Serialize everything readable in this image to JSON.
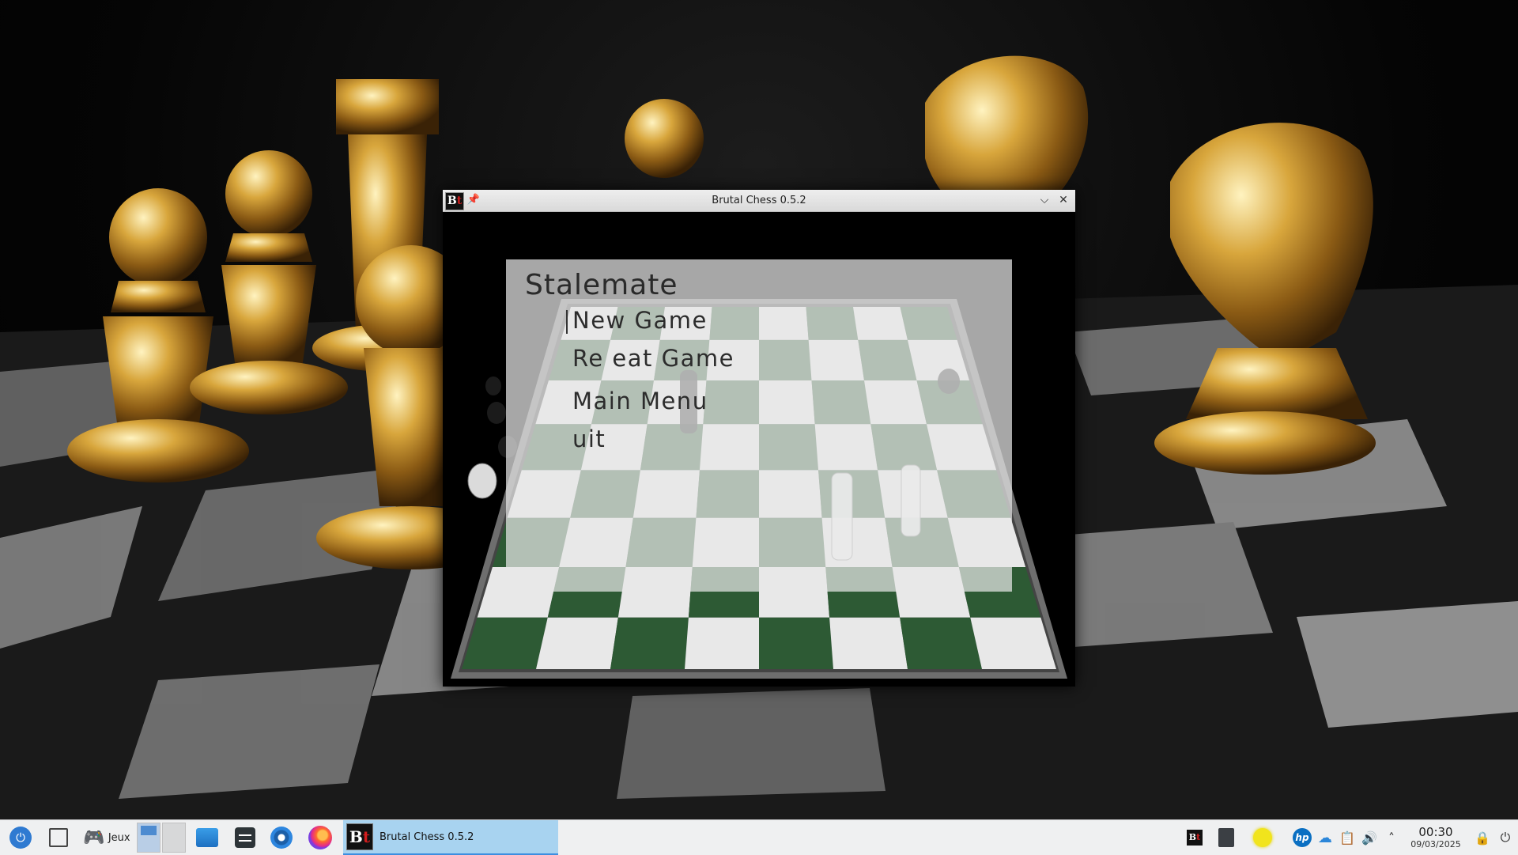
{
  "window": {
    "title": "Brutal Chess 0.5.2",
    "icon": "brutal-chess-icon",
    "icon_text": "B",
    "icon_accent": "t",
    "pin_icon": "pin-icon",
    "minimize_glyph": "⌵",
    "close_glyph": "✕"
  },
  "game": {
    "status_title": "Stalemate",
    "menu": [
      {
        "label": "New Game",
        "selected": true
      },
      {
        "label": "Re  eat Game",
        "selected": false
      },
      {
        "label": "Main Menu",
        "selected": false
      },
      {
        "label": "uit",
        "selected": false
      }
    ],
    "colors": {
      "dark_square": "#2d5a34",
      "light_square": "#e8e8e8",
      "overlay": "#e8e8e8"
    }
  },
  "taskbar": {
    "games_label": "Jeux",
    "active_task_label": "Brutal Chess 0.5.2",
    "games_icon": "🎮",
    "clock_time": "00:30",
    "clock_date": "09/03/2025",
    "tray_hp": "hp",
    "tray_network": "☁",
    "tray_clipboard": "📋",
    "tray_volume": "🔊",
    "tray_expand": "˄",
    "tray_lock": "🔒",
    "tray_power": "⏻"
  }
}
